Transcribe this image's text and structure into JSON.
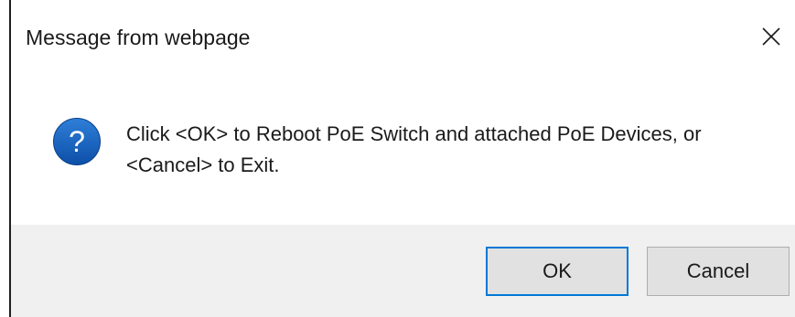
{
  "dialog": {
    "title": "Message from webpage",
    "message_line1": "Click <OK> to Reboot PoE Switch and attached PoE Devices, or",
    "message_line2": "<Cancel> to Exit.",
    "icon": "question-icon",
    "close_icon": "close-icon"
  },
  "buttons": {
    "ok_label": "OK",
    "cancel_label": "Cancel"
  },
  "colors": {
    "icon_blue": "#1565c0",
    "focus_border": "#0078d7",
    "footer_bg": "#f0f0f0"
  }
}
